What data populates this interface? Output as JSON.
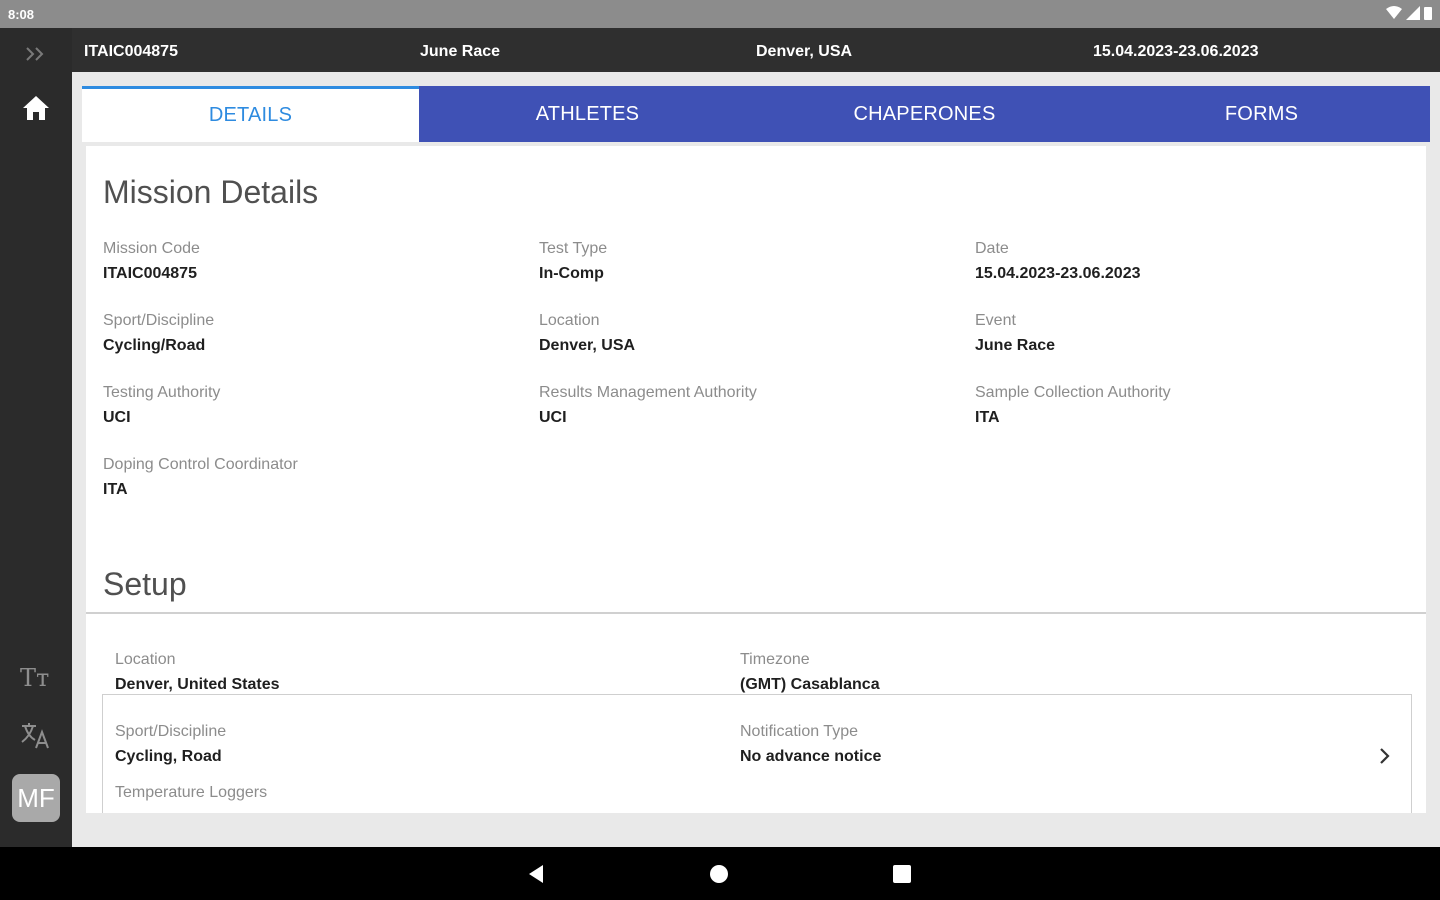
{
  "status_bar": {
    "time": "8:08"
  },
  "header": {
    "mission_code": "ITAIC004875",
    "event": "June Race",
    "location": "Denver, USA",
    "dates": "15.04.2023-23.06.2023"
  },
  "tabs": [
    {
      "label": "DETAILS",
      "active": true
    },
    {
      "label": "ATHLETES",
      "active": false
    },
    {
      "label": "CHAPERONES",
      "active": false
    },
    {
      "label": "FORMS",
      "active": false
    }
  ],
  "mission_details": {
    "title": "Mission Details",
    "fields": [
      {
        "label": "Mission Code",
        "value": "ITAIC004875"
      },
      {
        "label": "Test Type",
        "value": "In-Comp"
      },
      {
        "label": "Date",
        "value": "15.04.2023-23.06.2023"
      },
      {
        "label": "Sport/Discipline",
        "value": "Cycling/Road"
      },
      {
        "label": "Location",
        "value": "Denver, USA"
      },
      {
        "label": "Event",
        "value": "June Race"
      },
      {
        "label": "Testing Authority",
        "value": "UCI"
      },
      {
        "label": "Results Management Authority",
        "value": "UCI"
      },
      {
        "label": "Sample Collection Authority",
        "value": "ITA"
      },
      {
        "label": "Doping Control Coordinator",
        "value": "ITA"
      }
    ]
  },
  "setup": {
    "title": "Setup",
    "fields": [
      {
        "label": "Location",
        "value": "Denver, United States"
      },
      {
        "label": "Timezone",
        "value": "(GMT) Casablanca"
      },
      {
        "label": "Sport/Discipline",
        "value": "Cycling, Road"
      },
      {
        "label": "Notification Type",
        "value": "No advance notice"
      },
      {
        "label": "Temperature Loggers",
        "value": ""
      }
    ]
  },
  "rail": {
    "avatar_initials": "MF",
    "text_size_glyph": "Tт"
  },
  "colors": {
    "tab_bar": "#3f51b5",
    "active_tab_text": "#2e8be0"
  }
}
